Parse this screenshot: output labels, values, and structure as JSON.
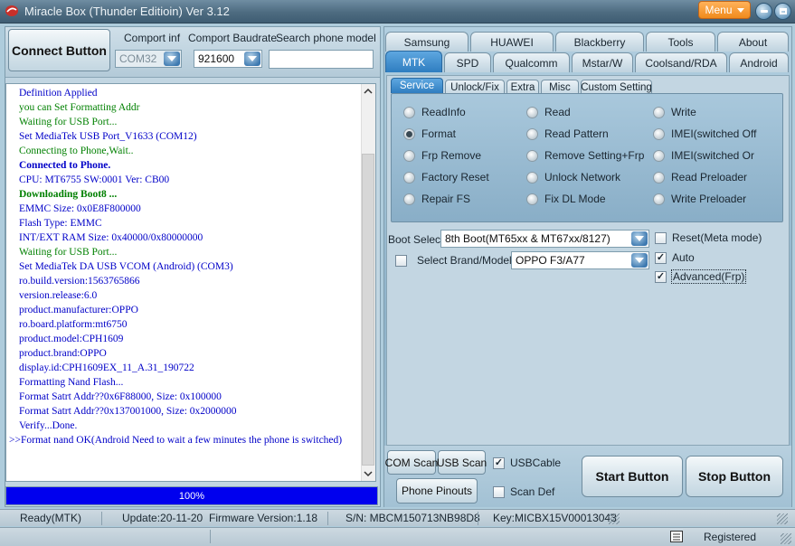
{
  "window": {
    "title": "Miracle Box (Thunder Editioin) Ver 3.12",
    "menu_label": "Menu"
  },
  "connection": {
    "connect_button": "Connect Button",
    "comport_label": "Comport inf",
    "comport_value": "COM32",
    "baud_label": "Comport Baudrate",
    "baud_value": "921600",
    "search_label": "Search phone model",
    "search_value": ""
  },
  "log": {
    "lines": [
      {
        "text": "Definition Applied",
        "style": "blue"
      },
      {
        "text": "you can Set Formatting Addr",
        "style": "green"
      },
      {
        "text": "Waiting for USB Port...",
        "style": "green"
      },
      {
        "text": "Set MediaTek USB Port_V1633 (COM12)",
        "style": "blue"
      },
      {
        "text": "Connecting to Phone,Wait..",
        "style": "green"
      },
      {
        "text": "Connected to Phone.",
        "style": "blue bold"
      },
      {
        "text": "CPU: MT6755 SW:0001 Ver: CB00",
        "style": "blue"
      },
      {
        "text": "Downloading Boot8 ...",
        "style": "green bold"
      },
      {
        "text": "EMMC Size: 0x0E8F800000",
        "style": "blue"
      },
      {
        "text": "Flash Type: EMMC",
        "style": "blue"
      },
      {
        "text": "INT/EXT RAM  Size: 0x40000/0x80000000",
        "style": "blue"
      },
      {
        "text": "Waiting for USB Port...",
        "style": "green"
      },
      {
        "text": "Set MediaTek DA USB VCOM (Android) (COM3)",
        "style": "blue"
      },
      {
        "text": "ro.build.version:1563765866",
        "style": "blue"
      },
      {
        "text": "version.release:6.0",
        "style": "blue"
      },
      {
        "text": "product.manufacturer:OPPO",
        "style": "blue"
      },
      {
        "text": "ro.board.platform:mt6750",
        "style": "blue"
      },
      {
        "text": "product.model:CPH1609",
        "style": "blue"
      },
      {
        "text": "product.brand:OPPO",
        "style": "blue"
      },
      {
        "text": "display.id:CPH1609EX_11_A.31_190722",
        "style": "blue"
      },
      {
        "text": "Formatting Nand Flash...",
        "style": "blue"
      },
      {
        "text": "Format Satrt Addr??0x6F88000, Size: 0x100000",
        "style": "blue"
      },
      {
        "text": "Format Satrt Addr??0x137001000, Size: 0x2000000",
        "style": "blue"
      },
      {
        "text": "Verify...Done.",
        "style": "blue"
      },
      {
        "text": ">>Format nand OK(Android Need to wait a few minutes the phone is switched)",
        "style": "blue wrap"
      }
    ]
  },
  "progress": {
    "value": 100,
    "label": "100%"
  },
  "tabs_row1": [
    "Samsung",
    "HUAWEI",
    "Blackberry",
    "Tools",
    "About"
  ],
  "tabs_row2": [
    "MTK",
    "SPD",
    "Qualcomm",
    "Mstar/W",
    "Coolsand/RDA",
    "Android"
  ],
  "active_tab": "MTK",
  "subtabs": [
    "Service",
    "Unlock/Fix",
    "Extra",
    "Misc",
    "Custom Setting"
  ],
  "active_subtab": "Service",
  "service_options": [
    [
      "ReadInfo",
      "Format",
      "Frp Remove",
      "Factory Reset",
      "Repair FS"
    ],
    [
      "Read",
      "Read Pattern",
      "Remove Setting+Frp",
      "Unlock Network",
      "Fix DL Mode"
    ],
    [
      "Write",
      "IMEI(switched Off",
      "IMEI(switched Or",
      "Read Preloader",
      "Write Preloader"
    ]
  ],
  "selected_option": "Format",
  "boot": {
    "label": "Boot Select:",
    "value": "8th Boot(MT65xx & MT67xx/8127)"
  },
  "brand": {
    "label": "Select Brand/Models",
    "checked": false,
    "value": "OPPO F3/A77"
  },
  "right_options": {
    "reset_meta": {
      "label": "Reset(Meta mode)",
      "checked": false
    },
    "auto": {
      "label": "Auto",
      "checked": true
    },
    "advanced_frp": {
      "label": "Advanced(Frp)",
      "checked": true
    }
  },
  "tools": {
    "com_scan": "COM Scan",
    "usb_scan": "USB Scan",
    "usb_cable": {
      "label": "USBCable",
      "checked": true
    },
    "phone_pinouts": "Phone Pinouts",
    "scan_def": {
      "label": "Scan Def",
      "checked": false
    },
    "start": "Start Button",
    "stop": "Stop Button"
  },
  "status": {
    "state": "Ready(MTK)",
    "update": "Update:20-11-20",
    "firmware": "Firmware Version:1.18",
    "serial": "S/N: MBCM150713NB98D8",
    "key": "Key:MICBX15V00013043",
    "registered": "Registered"
  },
  "colors": {
    "log_blue": "#0000c8",
    "log_green": "#008000",
    "progress": "#0000ee",
    "active_tab": "#2e7dc0",
    "menu": "#f08a1c"
  }
}
